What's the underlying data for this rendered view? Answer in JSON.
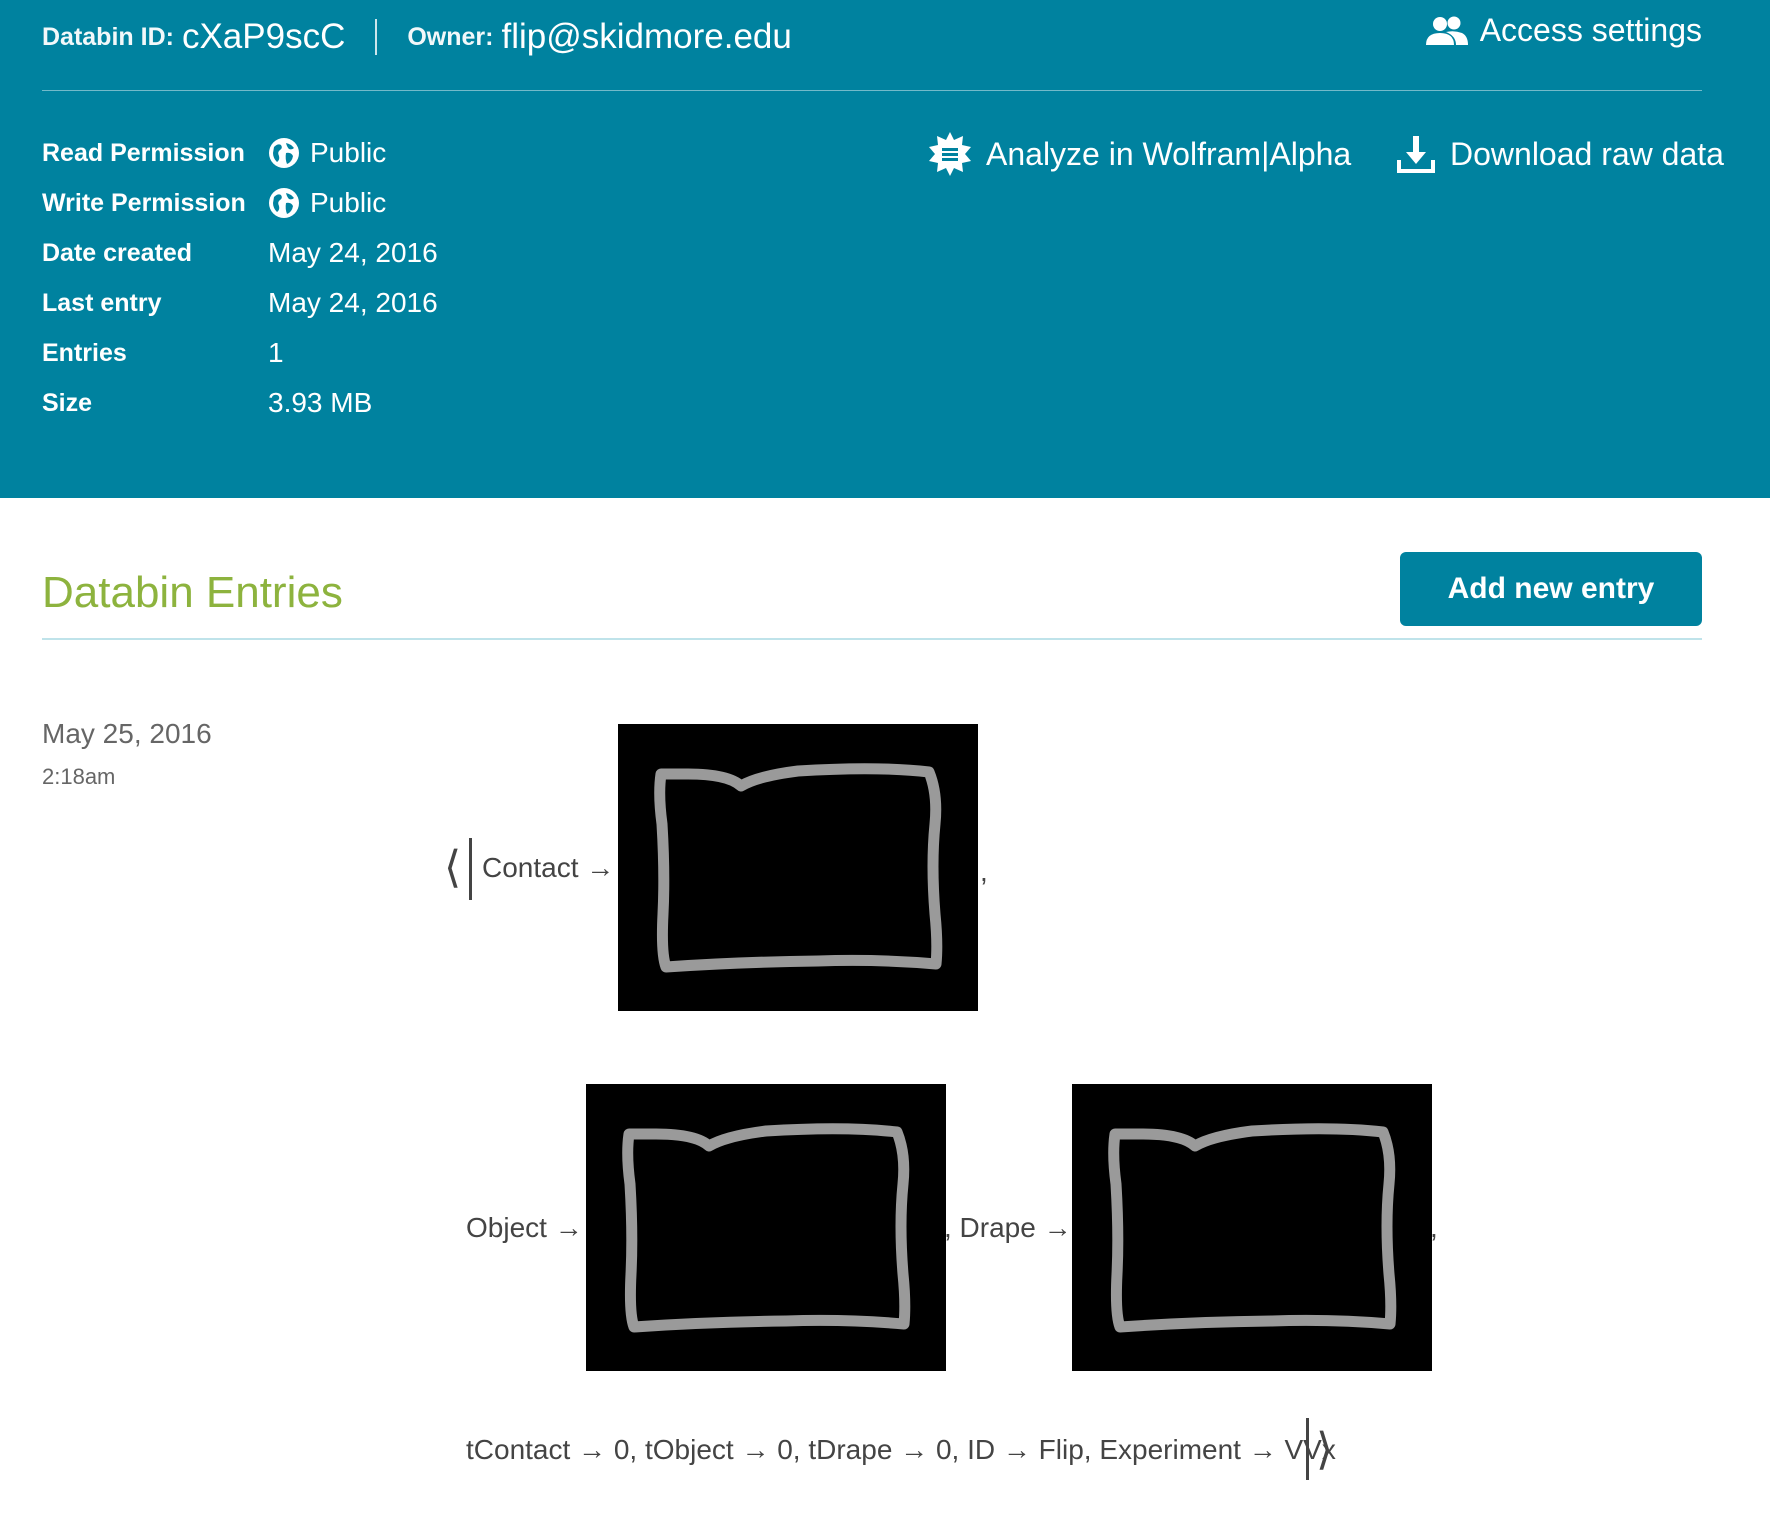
{
  "header": {
    "databin_id_label": "Databin ID:",
    "databin_id": "cXaP9scC",
    "owner_label": "Owner:",
    "owner": "flip@skidmore.edu",
    "access_settings": "Access settings",
    "analyze": "Analyze in Wolfram|Alpha",
    "download": "Download raw data",
    "background_color": "#00829f"
  },
  "meta": [
    {
      "label": "Read Permission",
      "value": "Public",
      "icon": "globe-icon"
    },
    {
      "label": "Write Permission",
      "value": "Public",
      "icon": "globe-icon"
    },
    {
      "label": "Date created",
      "value": "May 24, 2016"
    },
    {
      "label": "Last entry",
      "value": "May 24, 2016"
    },
    {
      "label": "Entries",
      "value": "1"
    },
    {
      "label": "Size",
      "value": "3.93 MB"
    }
  ],
  "section": {
    "title": "Databin Entries",
    "add_button": "Add new entry",
    "title_color": "#8db33e"
  },
  "entry": {
    "date": "May 25, 2016",
    "time": "2:18am",
    "open_bracket": "⟨",
    "close_bracket": "⟩",
    "contact_label": "Contact →",
    "comma_1": ",",
    "object_label": "Object →",
    "drape_label": ", Drape →",
    "comma_2": ",",
    "tail": "tContact → 0, tObject → 0, tDrape → 0, ID → Flip, Experiment → VVx"
  }
}
